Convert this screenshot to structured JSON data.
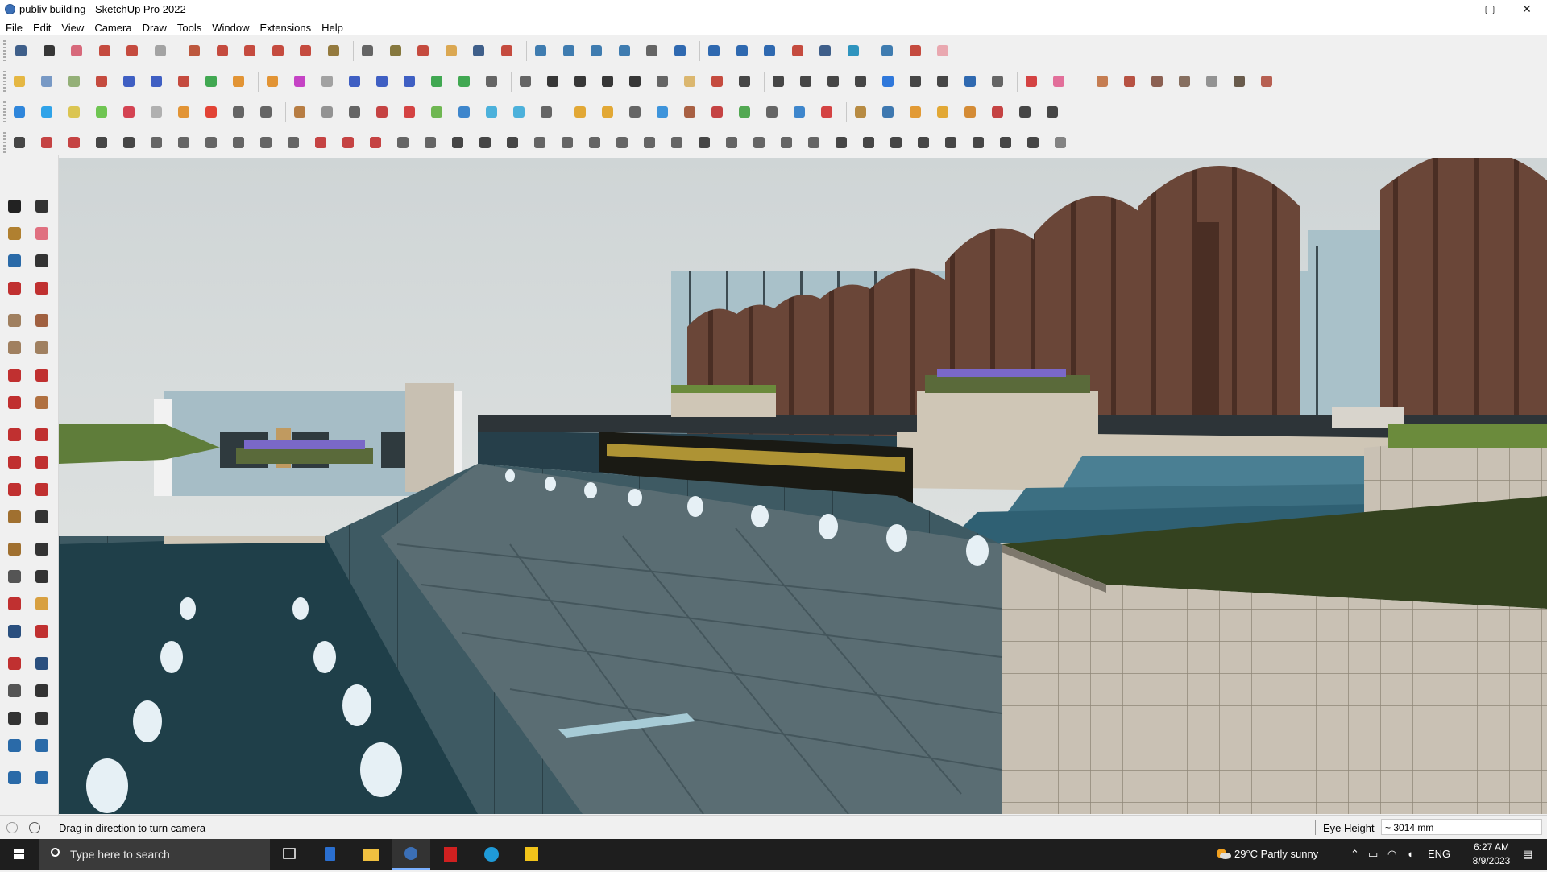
{
  "window": {
    "title": "publiv building - SketchUp Pro 2022",
    "controls": {
      "minimize": "–",
      "maximize": "▢",
      "close": "✕"
    }
  },
  "menu": [
    "File",
    "Edit",
    "View",
    "Camera",
    "Draw",
    "Tools",
    "Window",
    "Extensions",
    "Help"
  ],
  "toolbars": {
    "row1": [
      {
        "icon": "zoom-icon",
        "color": "#2b4f7e"
      },
      {
        "icon": "select-arrow-icon",
        "color": "#222222"
      },
      {
        "icon": "eraser-icon",
        "color": "#d45a6e"
      },
      {
        "icon": "pencil-icon",
        "color": "#c0392b"
      },
      {
        "icon": "arc-icon",
        "color": "#c0392b"
      },
      {
        "icon": "rectangle-icon",
        "color": "#9a9a9a"
      },
      {
        "icon": "push-pull-icon",
        "color": "#b7472a"
      },
      {
        "icon": "follow-me-icon",
        "color": "#c0392b"
      },
      {
        "icon": "move-icon",
        "color": "#c0392b"
      },
      {
        "icon": "rotate-icon",
        "color": "#c0392b"
      },
      {
        "icon": "scale-icon",
        "color": "#c0392b"
      },
      {
        "icon": "tape-measure-icon",
        "color": "#8a6d2a"
      },
      {
        "icon": "text-icon",
        "color": "#555555"
      },
      {
        "icon": "paint-bucket-icon",
        "color": "#7a6a2a"
      },
      {
        "icon": "orbit-icon",
        "color": "#c0392b"
      },
      {
        "icon": "pan-icon",
        "color": "#d8a040"
      },
      {
        "icon": "zoom-window-icon",
        "color": "#2b4f7e"
      },
      {
        "icon": "zoom-extents-icon",
        "color": "#c0392b"
      },
      {
        "icon": "warehouse-icon",
        "color": "#2b6fa8"
      },
      {
        "icon": "components-icon",
        "color": "#2b6fa8"
      },
      {
        "icon": "layers-icon",
        "color": "#2b6fa8"
      },
      {
        "icon": "extensions-icon",
        "color": "#2b6fa8"
      },
      {
        "icon": "account-icon",
        "color": "#555555"
      },
      {
        "icon": "section-plane-icon",
        "color": "#1a5aa8"
      },
      {
        "icon": "section-cut-icon",
        "color": "#1a5aa8"
      },
      {
        "icon": "axes-icon",
        "color": "#1a5aa8"
      },
      {
        "icon": "flip-icon",
        "color": "#1a5aa8"
      },
      {
        "icon": "mirror-icon",
        "color": "#c0392b"
      },
      {
        "icon": "measure-icon",
        "color": "#2b4f7e"
      },
      {
        "icon": "align-icon",
        "color": "#1a8ab8"
      },
      {
        "icon": "undo-icon",
        "color": "#2b6fa8"
      },
      {
        "icon": "redo-icon",
        "color": "#c0392b"
      },
      {
        "icon": "stop-icon",
        "color": "#e8a0a8"
      }
    ],
    "row2": [
      {
        "icon": "box-icon",
        "color": "#e3b030"
      },
      {
        "icon": "iso-view-icon",
        "color": "#6a8fc0"
      },
      {
        "icon": "box-green-icon",
        "color": "#8aa86a"
      },
      {
        "icon": "push-arrow-icon",
        "color": "#c0392b"
      },
      {
        "icon": "extrude-x-icon",
        "color": "#2b4fbe"
      },
      {
        "icon": "extrude-y-icon",
        "color": "#2b4fbe"
      },
      {
        "icon": "extrude-r-icon",
        "color": "#c0392b"
      },
      {
        "icon": "extrude-n-icon",
        "color": "#2ea040"
      },
      {
        "icon": "extrude-v-icon",
        "color": "#e08a20"
      },
      {
        "icon": "extrude-s-icon",
        "color": "#e08a20"
      },
      {
        "icon": "extrude-f-icon",
        "color": "#c030c0"
      },
      {
        "icon": "curve-icon",
        "color": "#999999"
      },
      {
        "icon": "slope-icon",
        "color": "#2b4fbe"
      },
      {
        "icon": "slope-alt-icon",
        "color": "#2b4fbe"
      },
      {
        "icon": "slope-third-icon",
        "color": "#2b4fbe"
      },
      {
        "icon": "green-tile-icon",
        "color": "#2ea040"
      },
      {
        "icon": "green-star-icon",
        "color": "#2ea040"
      },
      {
        "icon": "roof-icon",
        "color": "#555555"
      },
      {
        "icon": "door-icon",
        "color": "#555555"
      },
      {
        "icon": "house-icon",
        "color": "#222222"
      },
      {
        "icon": "house-frame-icon",
        "color": "#222222"
      },
      {
        "icon": "house-outline-icon",
        "color": "#222222"
      },
      {
        "icon": "house-base-icon",
        "color": "#222222"
      },
      {
        "icon": "function-icon",
        "color": "#555555"
      },
      {
        "icon": "leaf-icon",
        "color": "#d8b060"
      },
      {
        "icon": "ruler-icon",
        "color": "#c0392b"
      },
      {
        "icon": "square-shape-icon",
        "color": "#333333"
      },
      {
        "icon": "circle-shape-icon",
        "color": "#333333"
      },
      {
        "icon": "hexagon-shape-icon",
        "color": "#333333"
      },
      {
        "icon": "ellipse-shape-icon",
        "color": "#333333"
      },
      {
        "icon": "parallelogram-shape-icon",
        "color": "#333333"
      },
      {
        "icon": "arc-shape-icon",
        "color": "#1a6ad8"
      },
      {
        "icon": "helix-icon",
        "color": "#333333"
      },
      {
        "icon": "spiral-icon",
        "color": "#333333"
      },
      {
        "icon": "blob-icon",
        "color": "#1a5aa8"
      },
      {
        "icon": "rings-icon",
        "color": "#555555"
      },
      {
        "icon": "red-pen-icon",
        "color": "#d03030"
      },
      {
        "icon": "pink-eraser-icon",
        "color": "#e06090"
      }
    ],
    "row2b": [
      {
        "icon": "tag-icon",
        "color": "#c07040"
      },
      {
        "icon": "grid-red-icon",
        "color": "#b04030"
      },
      {
        "icon": "terrain-icon",
        "color": "#805040"
      },
      {
        "icon": "landscape-icon",
        "color": "#7a6050"
      },
      {
        "icon": "shell-icon",
        "color": "#888888"
      },
      {
        "icon": "fabric-icon",
        "color": "#5a4a3a"
      },
      {
        "icon": "triangle-mesh-icon",
        "color": "#b05040"
      }
    ],
    "row3": [
      {
        "icon": "cube-blue-icon",
        "color": "#1a7ad8"
      },
      {
        "icon": "cube-cyan-icon",
        "color": "#1a9ae8"
      },
      {
        "icon": "plane-yellow-icon",
        "color": "#d8c040"
      },
      {
        "icon": "plane-green-icon",
        "color": "#60c040"
      },
      {
        "icon": "plane-red-icon",
        "color": "#d03040"
      },
      {
        "icon": "plane-grey-icon",
        "color": "#a8a8a8"
      },
      {
        "icon": "rotate-orange-icon",
        "color": "#e08a20"
      },
      {
        "icon": "red-square-icon",
        "color": "#e03020"
      },
      {
        "icon": "list-icon",
        "color": "#555555"
      },
      {
        "icon": "flag-icon",
        "color": "#555555"
      },
      {
        "icon": "brick-icon",
        "color": "#b07030"
      },
      {
        "icon": "chain-icon",
        "color": "#888888"
      },
      {
        "icon": "line-offset-icon",
        "color": "#555555"
      },
      {
        "icon": "dots-icon",
        "color": "#c03030"
      },
      {
        "icon": "plus-red-icon",
        "color": "#d03030"
      },
      {
        "icon": "plus-green-icon",
        "color": "#60b040"
      },
      {
        "icon": "cross-blue-icon",
        "color": "#2a7ac8"
      },
      {
        "icon": "cone-icon",
        "color": "#3aaad8"
      },
      {
        "icon": "flask-icon",
        "color": "#3aaad8"
      },
      {
        "icon": "warning-icon",
        "color": "#555555"
      },
      {
        "icon": "loop-icon",
        "color": "#e0a020"
      },
      {
        "icon": "loop-cut-icon",
        "color": "#e0a020"
      },
      {
        "icon": "circle-arrows-icon",
        "color": "#555555"
      },
      {
        "icon": "star-move-icon",
        "color": "#2a8ad8"
      },
      {
        "icon": "bucket-icon",
        "color": "#a05030"
      },
      {
        "icon": "hook-icon",
        "color": "#c03030"
      },
      {
        "icon": "green-b-icon",
        "color": "#40a040"
      },
      {
        "icon": "merge-icon",
        "color": "#555555"
      },
      {
        "icon": "wand-icon",
        "color": "#2a7ac8"
      },
      {
        "icon": "gem-icon",
        "color": "#d03030"
      },
      {
        "icon": "chain-links-icon",
        "color": "#b08030"
      },
      {
        "icon": "window-frame-icon",
        "color": "#2a6aa8"
      },
      {
        "icon": "orange-grid-icon",
        "color": "#e09020"
      },
      {
        "icon": "orange-panel-icon",
        "color": "#e0a020"
      },
      {
        "icon": "orange-cross-icon",
        "color": "#d08020"
      },
      {
        "icon": "arrows-in-icon",
        "color": "#c03030"
      },
      {
        "icon": "dashed-arc-icon",
        "color": "#333333"
      },
      {
        "icon": "grid-lines-icon",
        "color": "#333333"
      }
    ],
    "row4": [
      {
        "icon": "path-icon",
        "color": "#333333"
      },
      {
        "icon": "dotted-curve-icon",
        "color": "#c03030"
      },
      {
        "icon": "car-icon",
        "color": "#c03030"
      },
      {
        "icon": "scissors-icon",
        "color": "#333333"
      },
      {
        "icon": "gear-shape-icon",
        "color": "#333333"
      },
      {
        "icon": "fold-icon",
        "color": "#555555"
      },
      {
        "icon": "pipe-icon",
        "color": "#555555"
      },
      {
        "icon": "cushion-icon",
        "color": "#555555"
      },
      {
        "icon": "sphere-icon",
        "color": "#555555"
      },
      {
        "icon": "twist-icon",
        "color": "#555555"
      },
      {
        "icon": "corner-icon",
        "color": "#555555"
      },
      {
        "icon": "corner-red-icon",
        "color": "#c03030"
      },
      {
        "icon": "line-red-icon",
        "color": "#c03030"
      },
      {
        "icon": "bend-red-icon",
        "color": "#c03030"
      },
      {
        "icon": "stamp-icon",
        "color": "#555555"
      },
      {
        "icon": "sail-icon",
        "color": "#555555"
      },
      {
        "icon": "columns-icon",
        "color": "#333333"
      },
      {
        "icon": "cage-icon",
        "color": "#333333"
      },
      {
        "icon": "hand-icon",
        "color": "#333333"
      },
      {
        "icon": "shell-shape-icon",
        "color": "#555555"
      },
      {
        "icon": "plane-fold-icon",
        "color": "#555555"
      },
      {
        "icon": "stack-icon",
        "color": "#555555"
      },
      {
        "icon": "slice-icon",
        "color": "#555555"
      },
      {
        "icon": "ribs-icon",
        "color": "#555555"
      },
      {
        "icon": "ribs-alt-icon",
        "color": "#555555"
      },
      {
        "icon": "spine-icon",
        "color": "#333333"
      },
      {
        "icon": "bowl-icon",
        "color": "#555555"
      },
      {
        "icon": "slats-icon",
        "color": "#555555"
      },
      {
        "icon": "arch-icon",
        "color": "#555555"
      },
      {
        "icon": "stair-icon",
        "color": "#555555"
      },
      {
        "icon": "rafters-icon",
        "color": "#333333"
      },
      {
        "icon": "hatch-icon",
        "color": "#333333"
      },
      {
        "icon": "louver-icon",
        "color": "#333333"
      },
      {
        "icon": "fence-icon",
        "color": "#333333"
      },
      {
        "icon": "turbine-icon",
        "color": "#333333"
      },
      {
        "icon": "fan-icon",
        "color": "#333333"
      },
      {
        "icon": "waves-icon",
        "color": "#333333"
      },
      {
        "icon": "brush-icon",
        "color": "#333333"
      },
      {
        "icon": "gem-outline-icon",
        "color": "#777777"
      }
    ],
    "left": [
      {
        "icon": "select-icon",
        "color": "#222222"
      },
      {
        "icon": "make-component-icon",
        "color": "#333333"
      },
      {
        "icon": "paint-icon",
        "color": "#b08030"
      },
      {
        "icon": "erase-icon",
        "color": "#e07080"
      },
      {
        "icon": "make-group-icon",
        "color": "#2a6aa8"
      },
      {
        "icon": "tape-icon",
        "color": "#333333"
      },
      {
        "icon": "line-icon",
        "color": "#c03030"
      },
      {
        "icon": "freehand-icon",
        "color": "#c03030"
      },
      {
        "icon": "rect-icon",
        "color": "#a08060"
      },
      {
        "icon": "rotated-rect-icon",
        "color": "#a06040"
      },
      {
        "icon": "circle-icon",
        "color": "#a08060"
      },
      {
        "icon": "polygon-icon",
        "color": "#a08060"
      },
      {
        "icon": "arc-draw-icon",
        "color": "#c03030"
      },
      {
        "icon": "arc-2pt-icon",
        "color": "#c03030"
      },
      {
        "icon": "arc-3pt-icon",
        "color": "#c03030"
      },
      {
        "icon": "pie-icon",
        "color": "#b07040"
      },
      {
        "icon": "move-tool-icon",
        "color": "#c03030"
      },
      {
        "icon": "pushpull-tool-icon",
        "color": "#c03030"
      },
      {
        "icon": "rotate-tool-icon",
        "color": "#c03030"
      },
      {
        "icon": "followme-tool-icon",
        "color": "#c03030"
      },
      {
        "icon": "scale-tool-icon",
        "color": "#c03030"
      },
      {
        "icon": "offset-tool-icon",
        "color": "#c03030"
      },
      {
        "icon": "tape-tool-icon",
        "color": "#a07030"
      },
      {
        "icon": "dimension-tool-icon",
        "color": "#333333"
      },
      {
        "icon": "protractor-tool-icon",
        "color": "#a07030"
      },
      {
        "icon": "text-tool-icon",
        "color": "#333333"
      },
      {
        "icon": "axes-tool-icon",
        "color": "#555555"
      },
      {
        "icon": "3d-text-tool-icon",
        "color": "#333333"
      },
      {
        "icon": "orbit-tool-icon",
        "color": "#c03030"
      },
      {
        "icon": "pan-tool-icon",
        "color": "#d8a040"
      },
      {
        "icon": "zoom-tool-icon",
        "color": "#2a4f7e"
      },
      {
        "icon": "zoom-window-tool-icon",
        "color": "#c03030"
      },
      {
        "icon": "zoom-extents-tool-icon",
        "color": "#c03030"
      },
      {
        "icon": "previous-view-icon",
        "color": "#2a4f7e"
      },
      {
        "icon": "position-camera-icon",
        "color": "#555555"
      },
      {
        "icon": "look-around-icon",
        "color": "#333333"
      },
      {
        "icon": "walk-icon",
        "color": "#333333"
      },
      {
        "icon": "section-tool-icon",
        "color": "#333333"
      },
      {
        "icon": "warehouse-tool-icon",
        "color": "#2a6aa8"
      },
      {
        "icon": "components-tool-icon",
        "color": "#2a6aa8"
      },
      {
        "icon": "layers-tool-icon",
        "color": "#2a6aa8"
      },
      {
        "icon": "extension-tool-icon",
        "color": "#2a6aa8"
      }
    ]
  },
  "statusbar": {
    "message": "Drag in direction to turn camera",
    "eye_height_label": "Eye Height",
    "eye_height_value": "~ 3014 mm"
  },
  "taskbar": {
    "search_placeholder": "Type here to search",
    "weather": "29°C  Partly sunny",
    "language": "ENG",
    "time": "6:27 AM",
    "date": "8/9/2023"
  }
}
